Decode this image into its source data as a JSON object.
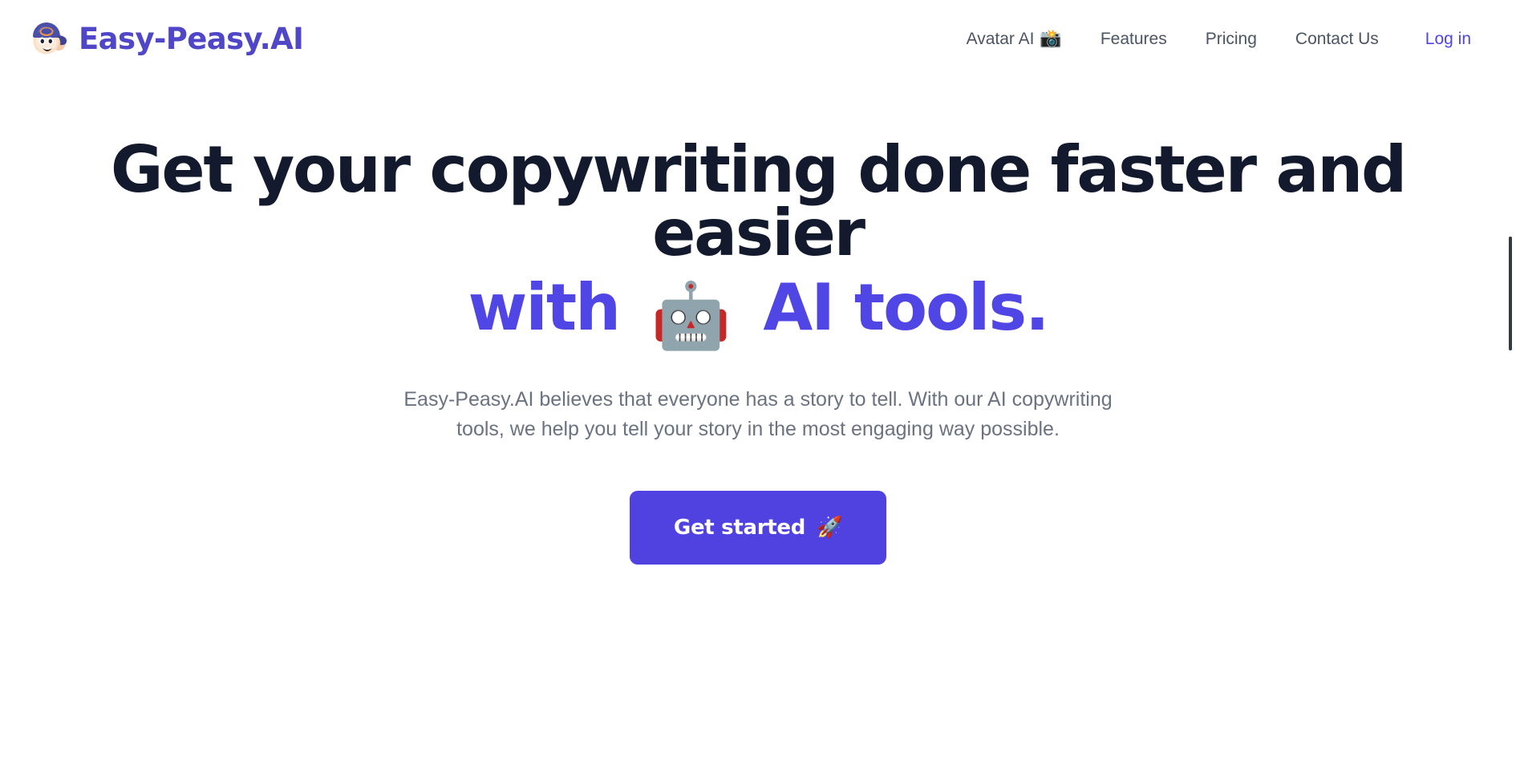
{
  "brand": {
    "name": "Easy-Peasy.AI",
    "logo_icon": "cartoon-face-with-cap-logo"
  },
  "nav": {
    "items": [
      {
        "label": "Avatar AI",
        "emoji": "📸",
        "emoji_name": "camera-with-flash-icon",
        "style": "default"
      },
      {
        "label": "Features",
        "emoji": "",
        "emoji_name": "",
        "style": "default"
      },
      {
        "label": "Pricing",
        "emoji": "",
        "emoji_name": "",
        "style": "default"
      },
      {
        "label": "Contact Us",
        "emoji": "",
        "emoji_name": "",
        "style": "default"
      },
      {
        "label": "Log in",
        "emoji": "",
        "emoji_name": "",
        "style": "accent"
      }
    ]
  },
  "hero": {
    "title_line1": "Get your copywriting done faster and",
    "title_line2": "easier",
    "accent_prefix": "with",
    "accent_suffix": "AI tools.",
    "robot_emoji": "🤖",
    "robot_emoji_name": "robot-face-icon",
    "subtitle": "Easy-Peasy.AI believes that everyone has a story to tell. With our AI copywriting tools, we help you tell your story in the most engaging way possible.",
    "cta_label": "Get started",
    "cta_emoji": "🚀",
    "cta_emoji_name": "rocket-icon"
  },
  "colors": {
    "accent": "#4f46e5",
    "cta_background": "#4f42e0",
    "heading": "#131a2e",
    "body_text": "#6b7280",
    "nav_text": "#4b5563",
    "brand_text": "#4f46c8",
    "page_background": "#ffffff",
    "scrollbar_thumb": "#343a40"
  }
}
